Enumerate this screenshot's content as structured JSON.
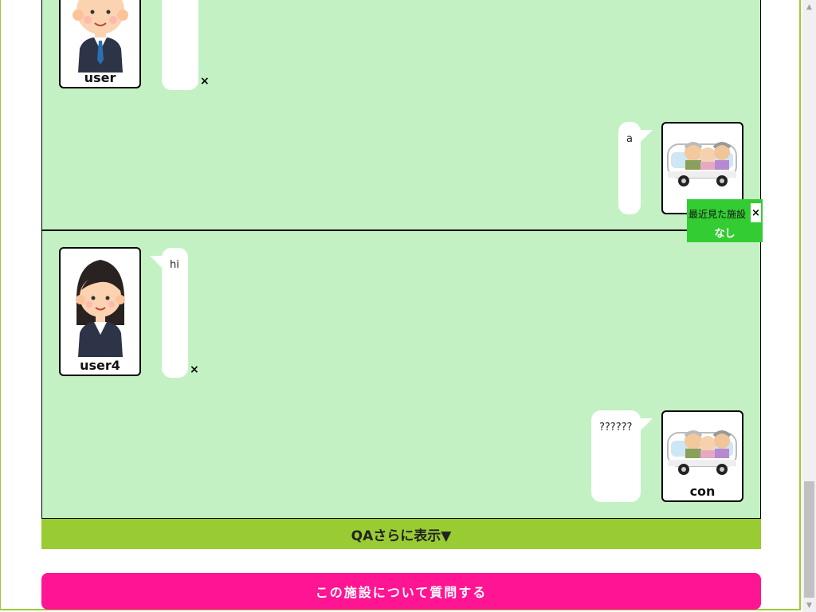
{
  "qa_threads": [
    {
      "question": {
        "user_name": "user",
        "text": "",
        "delete_label": "×"
      },
      "answer": {
        "user_name": "",
        "text": "a"
      }
    },
    {
      "question": {
        "user_name": "user4",
        "text": "hi",
        "delete_label": "×"
      },
      "answer": {
        "user_name": "con",
        "text": "??????"
      }
    }
  ],
  "more_label": "QAさらに表示▼",
  "ask_button_label": "この施設について質問する",
  "recent_panel": {
    "title": "最近見た施設",
    "close_label": "×",
    "value": "なし"
  },
  "colors": {
    "qa_background": "#c3f1c3",
    "more_bar": "#99cc33",
    "ask_button": "#ff1493",
    "recent_panel": "#33cc33"
  }
}
